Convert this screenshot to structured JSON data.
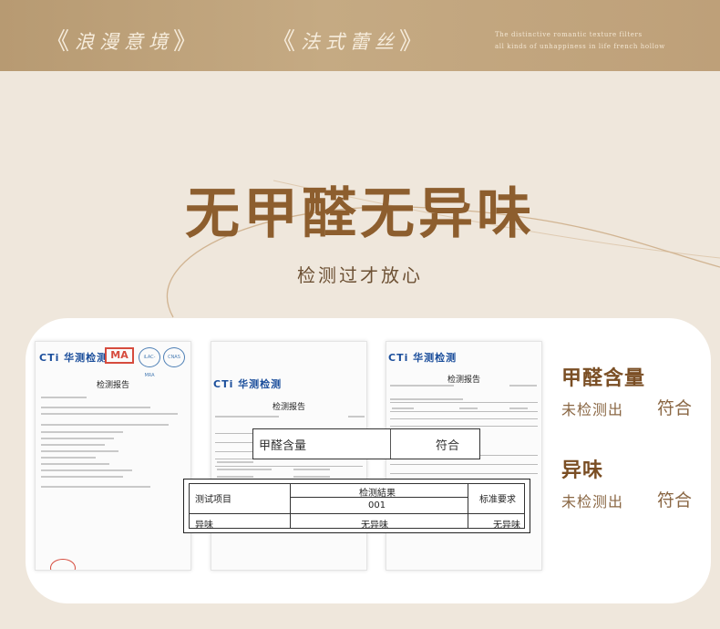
{
  "banner": {
    "tag1": "浪漫意境",
    "tag2": "法式蕾丝",
    "bracket_left": "《",
    "bracket_right": "》",
    "en_line1": "The distinctive romantic texture filters",
    "en_line2": "all kinds of unhappiness in life french hollow"
  },
  "header": {
    "headline": "无甲醛无异味",
    "subline": "检测过才放心"
  },
  "documents": {
    "doc1": {
      "logo": "CTi 华测检测",
      "seal": "MA",
      "title": "检测报告",
      "cert1": "iLAC-MRA",
      "cert2": "CNAS"
    },
    "doc2": {
      "logo": "CTi 华测检测",
      "title": "检测报告"
    },
    "doc3": {
      "logo": "CTi 华测检测",
      "title": "检测报告"
    }
  },
  "zoom_formaldehyde": {
    "item": "甲醛含量",
    "result": "符合"
  },
  "zoom_odor": {
    "col_item": "测试项目",
    "col_result": "检测結果",
    "col_standard": "标准要求",
    "result_code": "001",
    "row_item": "异味",
    "row_result": "无异味",
    "row_standard": "无异味"
  },
  "summary": [
    {
      "title": "甲醛含量",
      "detail": "未检测出",
      "verdict": "符合"
    },
    {
      "title": "异味",
      "detail": "未检测出",
      "verdict": "符合"
    }
  ],
  "colors": {
    "banner": "#c5aa83",
    "background": "#efe7dc",
    "headline": "#8d5e2e",
    "accent_brown": "#7a4e24"
  }
}
